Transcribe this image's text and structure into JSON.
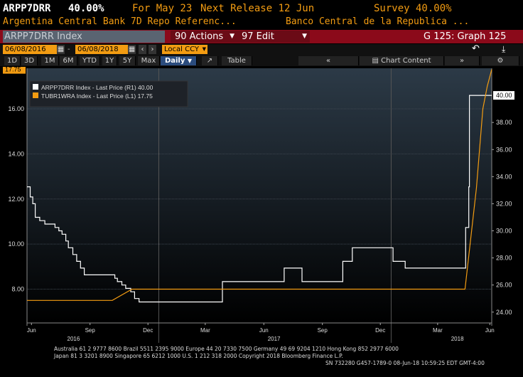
{
  "header": {
    "ticker": "ARPP7DRR",
    "last_value": "40.00%",
    "for_date": "For May 23",
    "next_release": "Next Release 12 Jun",
    "survey": "Survey 40.00%",
    "name_left": "Argentina Central Bank 7D Repo Referenc...",
    "name_right": "Banco Central de la Republica ..."
  },
  "toolbar": {
    "security": "ARPP7DRR Index",
    "actions_label": "90 Actions",
    "edit_label": "97 Edit",
    "graph_label": "G 125: Graph 125"
  },
  "range": {
    "start_date": "06/08/2016",
    "end_date": "06/08/2018",
    "currency": "Local CCY"
  },
  "periods": [
    "1D",
    "3D",
    "1M",
    "6M",
    "YTD",
    "1Y",
    "5Y",
    "Max"
  ],
  "frequency": "Daily",
  "table_label": "Table",
  "chart_content_label": "Chart Content",
  "footer": {
    "line1": "Australia 61 2 9777 8600 Brazil 5511 2395 9000 Europe 44 20 7330 7500 Germany 49 69 9204 1210 Hong Kong 852 2977 6000",
    "line2": "Japan 81 3 3201 8900        Singapore 65 6212 1000        U.S. 1 212 318 2000            Copyright 2018 Bloomberg Finance L.P.",
    "line3": "SN 732280 G457-1789-0 08-Jun-18 10:59:25 EDT  GMT-4:00"
  },
  "colors": {
    "accent_orange": "#f39c12",
    "toolbar_red": "#8b0a1a",
    "series_white": "#ffffff",
    "series_orange": "#f39c12"
  },
  "chart_data": {
    "type": "line",
    "grid": true,
    "legend_position": "top-left",
    "x_range": [
      "2016-06-08",
      "2018-06-08"
    ],
    "x_ticks": [
      {
        "date": "2016-06-15",
        "label": "Jun"
      },
      {
        "date": "2016-09-15",
        "label": "Sep"
      },
      {
        "date": "2016-12-15",
        "label": "Dec"
      },
      {
        "date": "2017-03-15",
        "label": "Mar"
      },
      {
        "date": "2017-06-15",
        "label": "Jun"
      },
      {
        "date": "2017-09-15",
        "label": "Sep"
      },
      {
        "date": "2017-12-15",
        "label": "Dec"
      },
      {
        "date": "2018-03-15",
        "label": "Mar"
      },
      {
        "date": "2018-06-05",
        "label": "Jun"
      }
    ],
    "year_labels": [
      {
        "date": "2016-08-20",
        "label": "2016"
      },
      {
        "date": "2017-07-01",
        "label": "2017"
      },
      {
        "date": "2018-04-15",
        "label": "2018"
      }
    ],
    "year_separators": [
      "2017-01-01",
      "2018-01-01"
    ],
    "left_axis": {
      "ticks": [
        "8.00",
        "10.00",
        "12.00",
        "14.00",
        "16.00"
      ],
      "ylim": [
        6.5,
        17.8
      ]
    },
    "right_axis": {
      "ticks": [
        "24.00",
        "26.00",
        "28.00",
        "30.00",
        "32.00",
        "34.00",
        "36.00",
        "38.00"
      ],
      "ylim": [
        23.2,
        42.0
      ]
    },
    "series": [
      {
        "name": "ARPP7DRR Index - Last Price (R1)",
        "last": "40.00",
        "axis": "right",
        "color": "#ffffff",
        "step": true,
        "points": [
          [
            "2016-06-08",
            33.25
          ],
          [
            "2016-06-13",
            32.5
          ],
          [
            "2016-06-17",
            32.0
          ],
          [
            "2016-06-21",
            31.0
          ],
          [
            "2016-06-28",
            30.75
          ],
          [
            "2016-07-06",
            30.5
          ],
          [
            "2016-07-22",
            30.25
          ],
          [
            "2016-07-28",
            30.0
          ],
          [
            "2016-08-02",
            29.75
          ],
          [
            "2016-08-08",
            29.25
          ],
          [
            "2016-08-12",
            28.75
          ],
          [
            "2016-08-19",
            28.25
          ],
          [
            "2016-08-25",
            27.75
          ],
          [
            "2016-08-31",
            27.25
          ],
          [
            "2016-09-06",
            26.75
          ],
          [
            "2016-10-24",
            26.5
          ],
          [
            "2016-10-28",
            26.25
          ],
          [
            "2016-11-04",
            26.0
          ],
          [
            "2016-11-10",
            25.75
          ],
          [
            "2016-11-18",
            25.5
          ],
          [
            "2016-11-24",
            25.0
          ],
          [
            "2016-12-01",
            24.75
          ],
          [
            "2017-04-11",
            26.25
          ],
          [
            "2017-07-13",
            26.25
          ],
          [
            "2017-07-17",
            27.25
          ],
          [
            "2017-08-07",
            27.25
          ],
          [
            "2017-08-14",
            26.25
          ],
          [
            "2017-10-16",
            26.25
          ],
          [
            "2017-10-17",
            27.75
          ],
          [
            "2017-11-01",
            28.75
          ],
          [
            "2017-12-27",
            28.75
          ],
          [
            "2018-01-04",
            27.75
          ],
          [
            "2018-01-23",
            27.25
          ],
          [
            "2018-04-28",
            30.25
          ],
          [
            "2018-05-03",
            33.25
          ],
          [
            "2018-05-04",
            40.0
          ],
          [
            "2018-06-08",
            40.0
          ]
        ]
      },
      {
        "name": "TUBR1WRA Index - Last Price (L1)",
        "last": "17.75",
        "axis": "left",
        "color": "#f39c12",
        "step": false,
        "points": [
          [
            "2016-06-08",
            7.5
          ],
          [
            "2016-10-20",
            7.5
          ],
          [
            "2016-11-20",
            8.0
          ],
          [
            "2017-04-30",
            8.0
          ],
          [
            "2018-04-27",
            8.0
          ],
          [
            "2018-05-15",
            12.5
          ],
          [
            "2018-05-25",
            16.0
          ],
          [
            "2018-06-01",
            17.0
          ],
          [
            "2018-06-08",
            17.75
          ]
        ]
      }
    ]
  }
}
